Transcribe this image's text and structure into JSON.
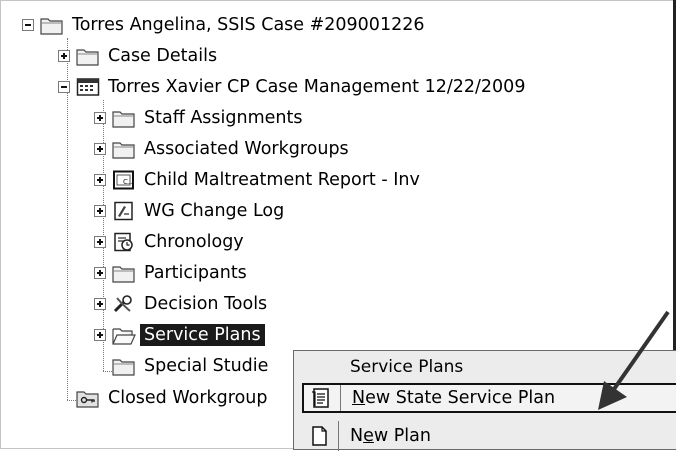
{
  "tree": {
    "root": {
      "label": "Torres Angelina, SSIS Case #209001226",
      "expanded": true,
      "icon": "folder-icon"
    },
    "level1": [
      {
        "label": "Case Details",
        "expander": "plus",
        "icon": "folder-icon"
      },
      {
        "label": "Torres Xavier CP Case Management 12/22/2009",
        "expander": "minus",
        "icon": "calendar-grid-icon"
      }
    ],
    "level2": [
      {
        "label": "Staff Assignments",
        "expander": "plus",
        "icon": "folder-icon"
      },
      {
        "label": "Associated Workgroups",
        "expander": "plus",
        "icon": "folder-icon"
      },
      {
        "label": "Child Maltreatment Report - Inv",
        "expander": "plus",
        "icon": "report-icon"
      },
      {
        "label": "WG Change Log",
        "expander": "plus",
        "icon": "log-icon"
      },
      {
        "label": "Chronology",
        "expander": "plus",
        "icon": "chronology-icon"
      },
      {
        "label": "Participants",
        "expander": "plus",
        "icon": "folder-icon"
      },
      {
        "label": "Decision Tools",
        "expander": "plus",
        "icon": "tools-icon"
      },
      {
        "label": "Service Plans",
        "expander": "plus",
        "icon": "open-folder-icon",
        "selected": true
      },
      {
        "label": "Special Studie",
        "expander": "none",
        "icon": "folder-icon"
      }
    ],
    "closed": {
      "label": "Closed Workgroup",
      "icon": "key-folder-icon"
    }
  },
  "context_menu": {
    "header": "Service Plans",
    "items": [
      {
        "label_underlined": "N",
        "label_rest": "ew State Service Plan",
        "icon": "document-list-icon",
        "highlighted": true
      },
      {
        "label_pre": "N",
        "label_underlined": "e",
        "label_rest": "w Plan",
        "icon": "blank-document-icon",
        "highlighted": false
      }
    ]
  },
  "annotation": {
    "icon": "arrow-pointer"
  }
}
